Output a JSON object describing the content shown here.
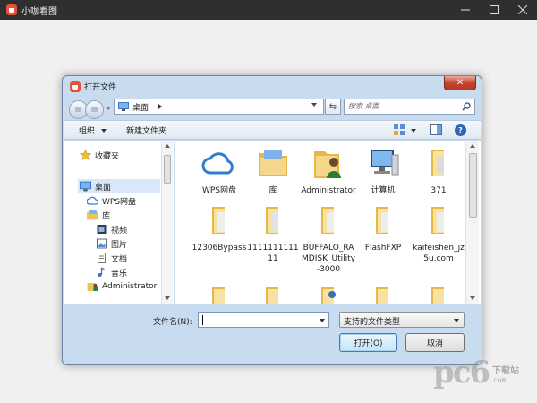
{
  "app": {
    "title": "小咖看图"
  },
  "dialog": {
    "title": "打开文件",
    "address": {
      "location": "桌面"
    },
    "search": {
      "placeholder": "搜索 桌面"
    },
    "toolbar": {
      "organize_label": "组织",
      "new_folder_label": "新建文件夹"
    },
    "nav": {
      "items": [
        {
          "label": "收藏夹",
          "icon": "star-icon",
          "selected": false
        },
        {
          "label": "桌面",
          "icon": "desktop-icon",
          "selected": true
        },
        {
          "label": "WPS网盘",
          "icon": "cloud-icon",
          "selected": false
        },
        {
          "label": "库",
          "icon": "library-icon",
          "selected": false
        },
        {
          "label": "视频",
          "icon": "video-icon",
          "selected": false
        },
        {
          "label": "图片",
          "icon": "picture-icon",
          "selected": false
        },
        {
          "label": "文档",
          "icon": "document-icon",
          "selected": false
        },
        {
          "label": "音乐",
          "icon": "music-icon",
          "selected": false
        },
        {
          "label": "Administrator",
          "icon": "user-folder-icon",
          "selected": false
        }
      ]
    },
    "files": [
      {
        "name": "WPS网盘",
        "icon": "cloud-icon"
      },
      {
        "name": "库",
        "icon": "library-folder-icon"
      },
      {
        "name": "Administrator",
        "icon": "user-folder-icon"
      },
      {
        "name": "计算机",
        "icon": "computer-icon"
      },
      {
        "name": "371",
        "icon": "folder-icon"
      },
      {
        "name": "12306Bypass",
        "icon": "folder-icon"
      },
      {
        "name": "111111111111",
        "icon": "folder-icon"
      },
      {
        "name": "BUFFALO_RAMDISK_Utility-3000",
        "icon": "folder-icon"
      },
      {
        "name": "FlashFXP",
        "icon": "folder-icon"
      },
      {
        "name": "kaifeishen_jz5u.com",
        "icon": "folder-icon"
      },
      {
        "name": "",
        "icon": "folder-icon"
      },
      {
        "name": "",
        "icon": "folder-icon"
      },
      {
        "name": "",
        "icon": "folder-icon"
      },
      {
        "name": "",
        "icon": "folder-icon"
      },
      {
        "name": "",
        "icon": "folder-icon"
      }
    ],
    "filename": {
      "label": "文件名(N):",
      "value": ""
    },
    "filter": {
      "selected": "支持的文件类型"
    },
    "buttons": {
      "open": "打开(O)",
      "cancel": "取消"
    }
  },
  "watermark": {
    "logo": "pc6",
    "site": "下载站",
    "url": ".com"
  },
  "colors": {
    "titlebar": "#2f2f2f",
    "dialog_frame": "#c8dbef",
    "selection": "#d9e8f8",
    "folder": "#f0cf6e"
  }
}
